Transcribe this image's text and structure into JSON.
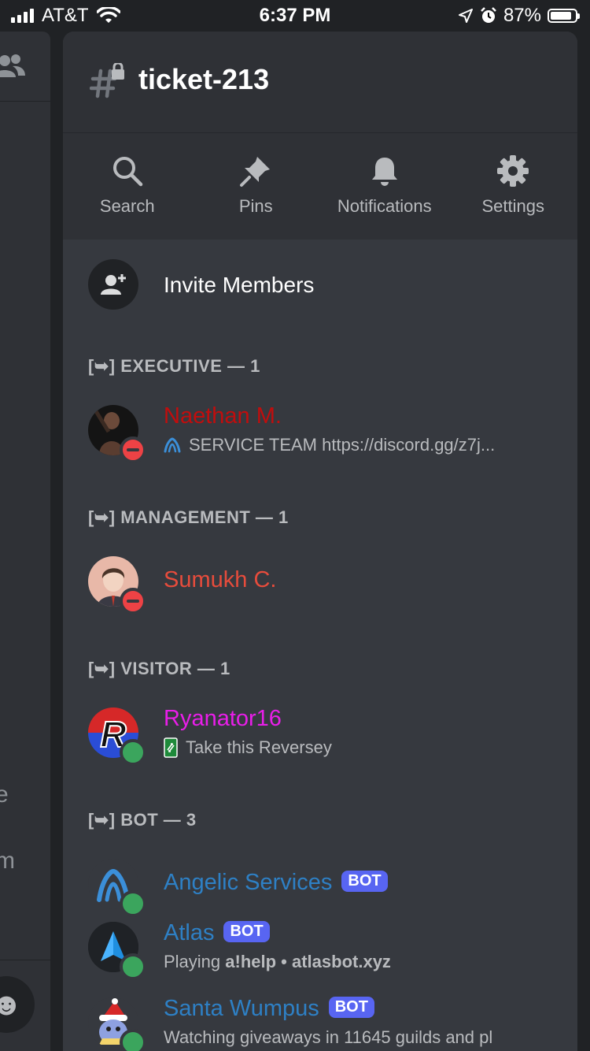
{
  "status_bar": {
    "carrier": "AT&T",
    "time": "6:37 PM",
    "battery": "87%",
    "battery_level": 0.87
  },
  "left_pane": {
    "partial_text_1": "e",
    "partial_text_2": "m",
    "emoji_icon": "smile-icon"
  },
  "channel": {
    "name": "ticket-213",
    "icon": "hash-lock-icon"
  },
  "actions": [
    {
      "label": "Search",
      "icon": "search-icon"
    },
    {
      "label": "Pins",
      "icon": "pin-icon"
    },
    {
      "label": "Notifications",
      "icon": "bell-icon"
    },
    {
      "label": "Settings",
      "icon": "gear-icon"
    }
  ],
  "invite": {
    "label": "Invite Members",
    "icon": "add-user-icon"
  },
  "sections": [
    {
      "header": "[➥] EXECUTIVE — 1"
    },
    {
      "header": "[➥] MANAGEMENT — 1"
    },
    {
      "header": "[➥] VISITOR — 1"
    },
    {
      "header": "[➥] BOT — 3"
    }
  ],
  "members": [
    {
      "name": "Naethan M.",
      "color": "#c10d0d",
      "status": "dnd",
      "activity": "SERVICE TEAM https://discord.gg/z7j..."
    },
    {
      "name": "Sumukh C.",
      "color": "#e74c3c",
      "status": "dnd",
      "activity": ""
    },
    {
      "name": "Ryanator16",
      "color": "#e91ee9",
      "status": "online",
      "activity": "Take this Reversey"
    },
    {
      "name": "Angelic Services",
      "color": "#2e80c5",
      "status": "online",
      "bot": "BOT",
      "activity": ""
    },
    {
      "name": "Atlas",
      "color": "#2e80c5",
      "status": "online",
      "bot": "BOT",
      "activity_prefix": "Playing ",
      "activity_bold": "a!help • atlasbot.xyz"
    },
    {
      "name": "Santa Wumpus",
      "color": "#2e80c5",
      "status": "online",
      "bot": "BOT",
      "activity": "Watching giveaways in 11645 guilds and pl"
    }
  ]
}
